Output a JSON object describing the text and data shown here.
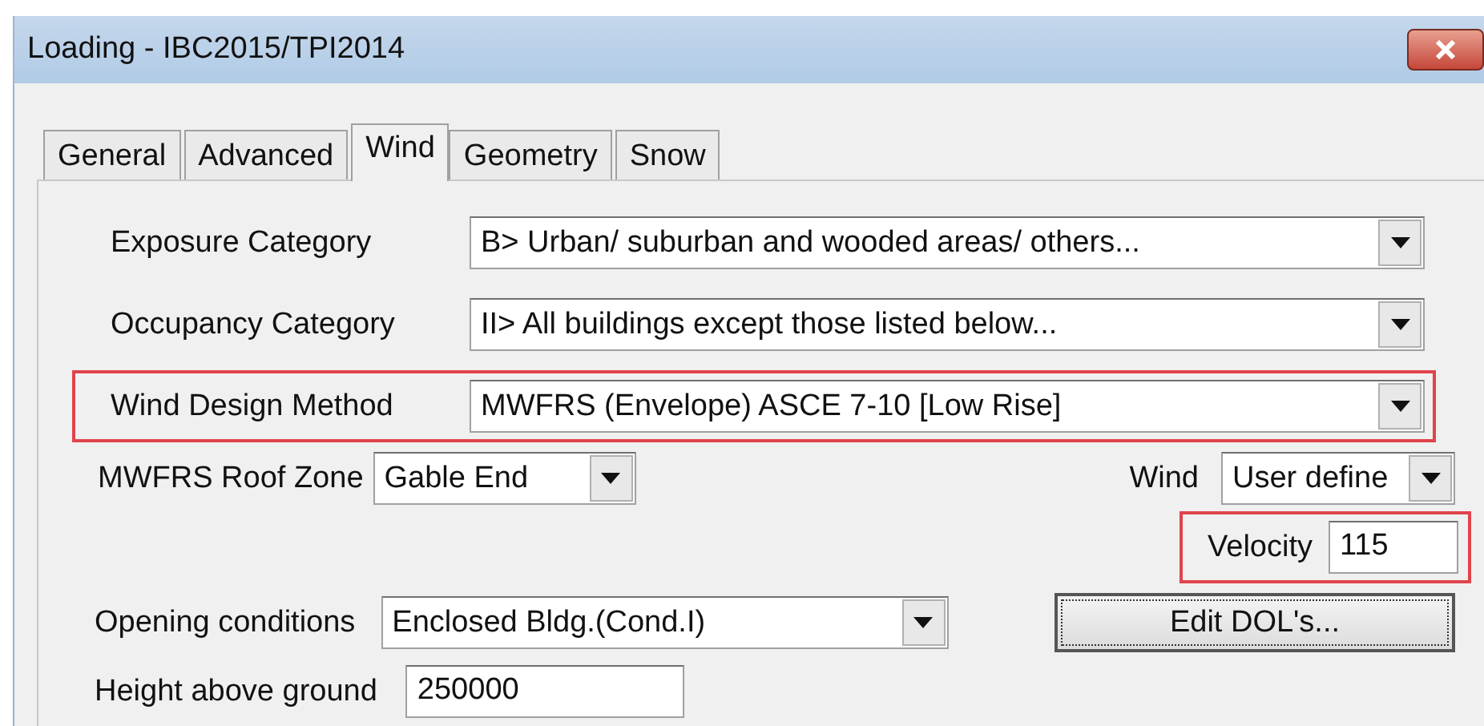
{
  "window": {
    "title": "Loading - IBC2015/TPI2014"
  },
  "tabs": [
    {
      "label": "General",
      "selected": false
    },
    {
      "label": "Advanced",
      "selected": false
    },
    {
      "label": "Wind",
      "selected": true
    },
    {
      "label": "Geometry",
      "selected": false
    },
    {
      "label": "Snow",
      "selected": false
    }
  ],
  "category_rows": [
    {
      "label": "Exposure Category",
      "value": "B> Urban/ suburban and wooded areas/ others...",
      "highlighted": false
    },
    {
      "label": "Occupancy Category",
      "value": "II> All buildings except those listed below...",
      "highlighted": false
    },
    {
      "label": "Wind Design Method",
      "value": "MWFRS (Envelope) ASCE 7-10 [Low Rise]",
      "highlighted": true
    }
  ],
  "roof_zone": {
    "label": "MWFRS Roof Zone",
    "value": "Gable End"
  },
  "wind": {
    "label": "Wind",
    "value": "User define"
  },
  "velocity": {
    "label": "Velocity",
    "value": "115",
    "highlighted": true
  },
  "opening_conditions": {
    "label": "Opening conditions",
    "value": "Enclosed Bldg.(Cond.I)"
  },
  "edit_button": "Edit DOL's...",
  "height_above_ground": {
    "label": "Height above ground",
    "value": "250000"
  }
}
